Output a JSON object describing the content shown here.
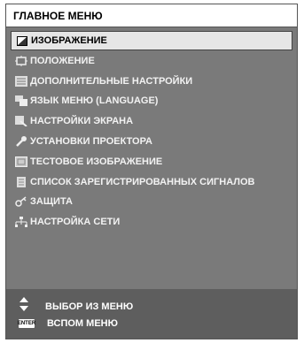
{
  "header": {
    "title": "ГЛАВНОЕ МЕНЮ"
  },
  "menu": {
    "items": [
      {
        "label": "ИЗОБРАЖЕНИЕ",
        "icon": "picture-icon"
      },
      {
        "label": "ПОЛОЖЕНИЕ",
        "icon": "position-icon"
      },
      {
        "label": "ДОПОЛНИТЕЛЬНЫЕ НАСТРОЙКИ",
        "icon": "advanced-settings-icon"
      },
      {
        "label": "ЯЗЫК МЕНЮ (LANGUAGE)",
        "icon": "language-icon"
      },
      {
        "label": "НАСТРОЙКИ ЭКРАНА",
        "icon": "screen-settings-icon"
      },
      {
        "label": "УСТАНОВКИ ПРОЕКТОРА",
        "icon": "projector-settings-icon"
      },
      {
        "label": "ТЕСТОВОЕ ИЗОБРАЖЕНИЕ",
        "icon": "test-pattern-icon"
      },
      {
        "label": "СПИСОК ЗАРЕГИСТРИРОВАННЫХ СИГНАЛОВ",
        "icon": "signal-list-icon"
      },
      {
        "label": "ЗАЩИТА",
        "icon": "security-key-icon"
      },
      {
        "label": "НАСТРОЙКА СЕТИ",
        "icon": "network-icon"
      }
    ],
    "selected_index": 0
  },
  "footer": {
    "select_label": "ВЫБОР ИЗ МЕНЮ",
    "submenu_label": "ВСПОМ МЕНЮ",
    "enter_key": "ENTER"
  }
}
